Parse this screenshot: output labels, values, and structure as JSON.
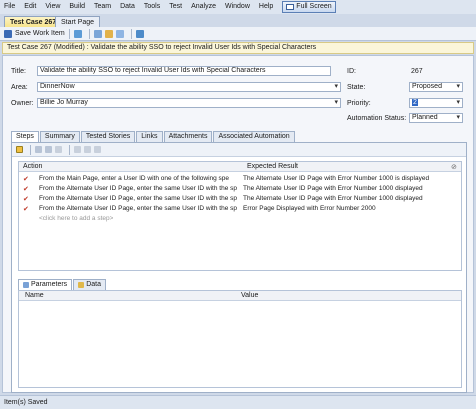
{
  "menu": [
    "File",
    "Edit",
    "View",
    "Build",
    "Team",
    "Data",
    "Tools",
    "Test",
    "Analyze",
    "Window",
    "Help"
  ],
  "fullscreen_label": "Full Screen",
  "doc_tabs": {
    "active": "Test Case 267*",
    "inactive": "Start Page"
  },
  "toolbar": {
    "save_label": "Save Work Item"
  },
  "work_item_title": "Test Case 267 (Modified) : Validate the ability SSO to reject Invalid User Ids with Special Characters",
  "form": {
    "title_label": "Title:",
    "title_value": "Validate the ability SSO to reject Invalid User Ids with Special Characters",
    "area_label": "Area:",
    "area_value": "DinnerNow",
    "owner_label": "Owner:",
    "owner_value": "Billie Jo Murray",
    "id_label": "ID:",
    "id_value": "267",
    "state_label": "State:",
    "state_value": "Proposed",
    "priority_label": "Priority:",
    "priority_value": "2",
    "automation_label": "Automation Status:",
    "automation_value": "Planned"
  },
  "tabs": [
    "Steps",
    "Summary",
    "Tested Stories",
    "Links",
    "Attachments",
    "Associated Automation"
  ],
  "steps": {
    "columns": {
      "action": "Action",
      "expected": "Expected Result"
    },
    "rows": [
      {
        "action": "From the Main Page, enter a User ID with one of the following spe",
        "expected": "The Alternate User ID Page with Error Number 1000 is displayed"
      },
      {
        "action": "From the Alternate User ID Page, enter the same User ID with the sp",
        "expected": "The Alternate User ID Page with Error Number 1000 displayed"
      },
      {
        "action": "From the Alternate User ID Page, enter the same User ID with the sp",
        "expected": "The Alternate User ID Page with Error Number 1000 displayed"
      },
      {
        "action": "From the Alternate User ID Page, enter the same User ID with the sp",
        "expected": "Error Page Displayed with Error Number 2000"
      }
    ],
    "add_step": "<click here to add a step>"
  },
  "param_tabs": {
    "parameters": "Parameters",
    "data": "Data"
  },
  "param_columns": {
    "name": "Name",
    "value": "Value"
  },
  "status": "Item(s) Saved"
}
